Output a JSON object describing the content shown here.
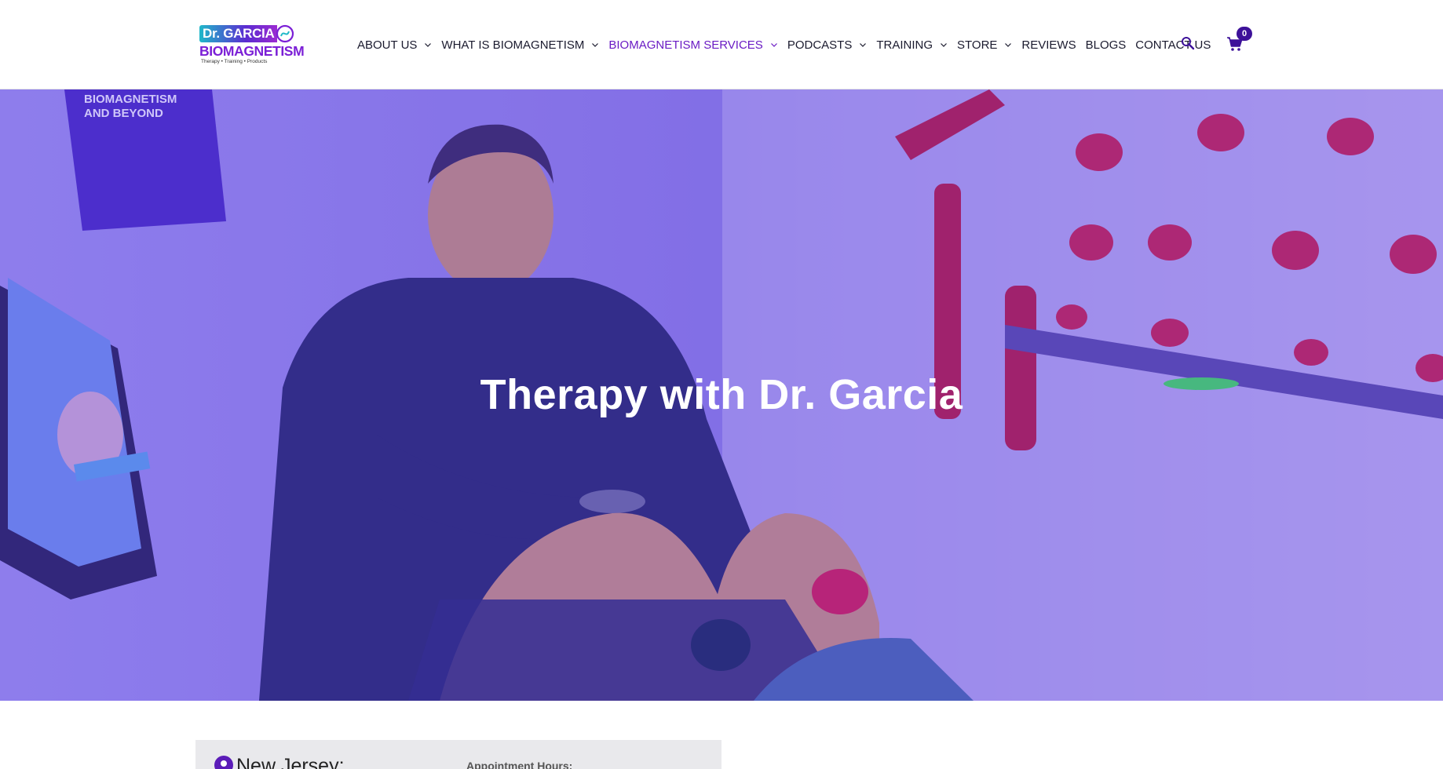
{
  "brand": {
    "logo_top": "Dr. GARCIA",
    "logo_name": "BIOMAGNETISM",
    "logo_tagline": "Therapy • Training • Products"
  },
  "nav": {
    "items": [
      {
        "label": "ABOUT US",
        "has_dropdown": true,
        "active": false
      },
      {
        "label": "WHAT IS BIOMAGNETISM",
        "has_dropdown": true,
        "active": false
      },
      {
        "label": "BIOMAGNETISM SERVICES",
        "has_dropdown": true,
        "active": true
      },
      {
        "label": "PODCASTS",
        "has_dropdown": true,
        "active": false
      },
      {
        "label": "TRAINING",
        "has_dropdown": true,
        "active": false
      },
      {
        "label": "STORE",
        "has_dropdown": true,
        "active": false
      },
      {
        "label": "REVIEWS",
        "has_dropdown": false,
        "active": false
      },
      {
        "label": "BLOGS",
        "has_dropdown": false,
        "active": false
      },
      {
        "label": "CONTACT US",
        "has_dropdown": false,
        "active": false
      }
    ],
    "search_icon": "search-icon",
    "cart_icon": "cart-icon",
    "cart_count": "0"
  },
  "hero": {
    "title": "Therapy with Dr. Garcia",
    "poster_title": "BIOMAGNETISM AND BEYOND"
  },
  "location_panel": {
    "location": "New Jersey:",
    "hours_label": "Appointment Hours:"
  },
  "colors": {
    "accent": "#6a1bc4",
    "hero_overlay": "#7a5cf0",
    "badge": "#3d1199"
  }
}
